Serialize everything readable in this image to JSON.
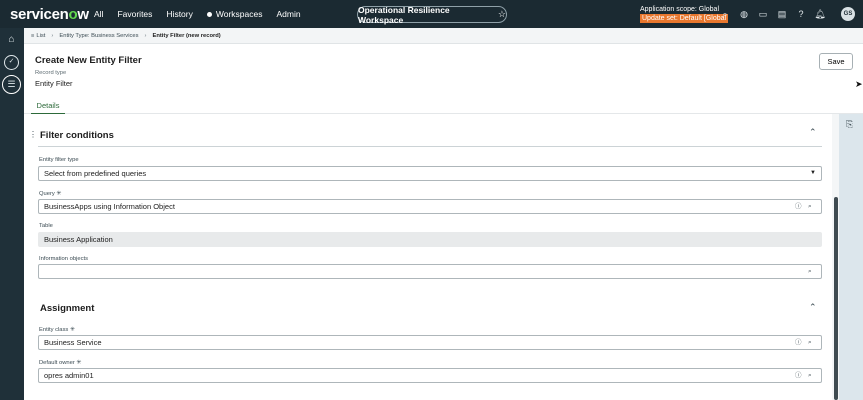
{
  "header": {
    "logo_prefix": "servicen",
    "logo_o": "o",
    "logo_suffix": "w",
    "nav": [
      "All",
      "Favorites",
      "History",
      "Workspaces",
      "Admin"
    ],
    "workspace": "Operational Resilience Workspace",
    "scope_line": "Application scope: Global",
    "update_set": "Update set: Default [Global",
    "avatar_initials": "GS",
    "icons": [
      "search-icon",
      "globe-icon",
      "chat-icon",
      "news-icon",
      "help-icon",
      "bell-icon"
    ]
  },
  "breadcrumb": {
    "list": "List",
    "level1": "Entity Type: Business Services",
    "current": "Entity Filter (new record)"
  },
  "record": {
    "title": "Create New Entity Filter",
    "type_label": "Record type",
    "type_value": "Entity Filter",
    "tab": "Details",
    "save": "Save"
  },
  "filter_section": {
    "title": "Filter conditions",
    "entity_filter_type_label": "Entity filter type",
    "entity_filter_type_value": "Select from predefined queries",
    "query_label": "Query",
    "query_value": "BusinessApps using Information Object",
    "table_label": "Table",
    "table_value": "Business Application",
    "info_objects_label": "Information objects",
    "info_objects_value": ""
  },
  "assignment_section": {
    "title": "Assignment",
    "entity_class_label": "Entity class",
    "entity_class_value": "Business Service",
    "default_owner_label": "Default owner",
    "default_owner_value": "opres admin01"
  },
  "required_marker": "✳"
}
